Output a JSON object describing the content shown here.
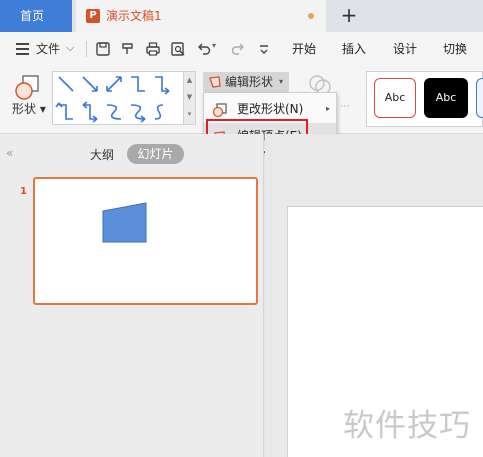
{
  "tabs": {
    "home": "首页",
    "document": "演示文稿1",
    "document_icon": "P"
  },
  "menu": {
    "file": "文件",
    "items": [
      "开始",
      "插入",
      "设计",
      "切换"
    ]
  },
  "ribbon": {
    "shape_label": "形状",
    "edit_shape_button": "编辑形状",
    "style_presets": [
      "Abc",
      "Abc"
    ]
  },
  "dropdown": {
    "change_shape": "更改形状(N)",
    "edit_points": "编辑顶点(E)"
  },
  "left_pane": {
    "outline_tab": "大纲",
    "slides_tab": "幻灯片",
    "slide_number": "1"
  },
  "watermark": "软件技巧",
  "colors": {
    "accent_tab": "#3f7ed8",
    "doc_orange": "#d7512a",
    "thumb_shape": "#5b8fd9",
    "highlight_box": "#e02020"
  },
  "icons": [
    "menu-icon",
    "save-icon",
    "format-painter-icon",
    "print-icon",
    "print-preview-icon",
    "undo-icon",
    "redo-icon",
    "more-icon",
    "edit-shape-icon",
    "change-shape-icon",
    "edit-points-icon"
  ]
}
